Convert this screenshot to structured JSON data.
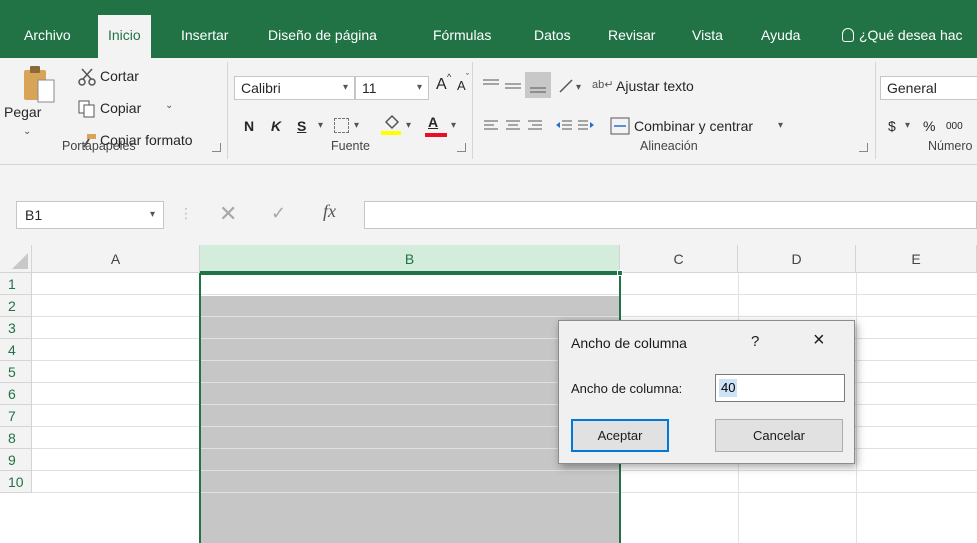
{
  "menu": {
    "tabs": [
      "Archivo",
      "Inicio",
      "Insertar",
      "Diseño de página",
      "Fórmulas",
      "Datos",
      "Revisar",
      "Vista",
      "Ayuda"
    ],
    "active_tab": "Inicio",
    "tell_me": "¿Qué desea hac"
  },
  "clipboard": {
    "paste": "Pegar",
    "cut": "Cortar",
    "copy": "Copiar",
    "format_painter": "Copiar formato",
    "label": "Portapapeles"
  },
  "font": {
    "name": "Calibri",
    "size": "11",
    "grow": "A",
    "shrink": "A",
    "bold": "N",
    "italic": "K",
    "underline": "S",
    "font_color_letter": "A",
    "label": "Fuente",
    "font_color": "#e81123",
    "highlight_color": "#ffff00"
  },
  "alignment": {
    "wrap_text": "Ajustar texto",
    "merge_center": "Combinar y centrar",
    "label": "Alineación"
  },
  "number": {
    "format": "General",
    "currency": "$",
    "percent": "%",
    "thousands": "000",
    "label": "Número"
  },
  "formula_bar": {
    "name_box": "B1",
    "fx": "fx",
    "value": ""
  },
  "grid": {
    "columns": [
      "A",
      "B",
      "C",
      "D",
      "E"
    ],
    "selected_column": "B",
    "rows": [
      "1",
      "2",
      "3",
      "4",
      "5",
      "6",
      "7",
      "8",
      "9",
      "10"
    ],
    "accent_color": "#217346"
  },
  "dialog": {
    "title": "Ancho de columna",
    "help": "?",
    "close": "×",
    "field_label": "Ancho de columna:",
    "field_value": "40",
    "ok": "Aceptar",
    "cancel": "Cancelar"
  }
}
